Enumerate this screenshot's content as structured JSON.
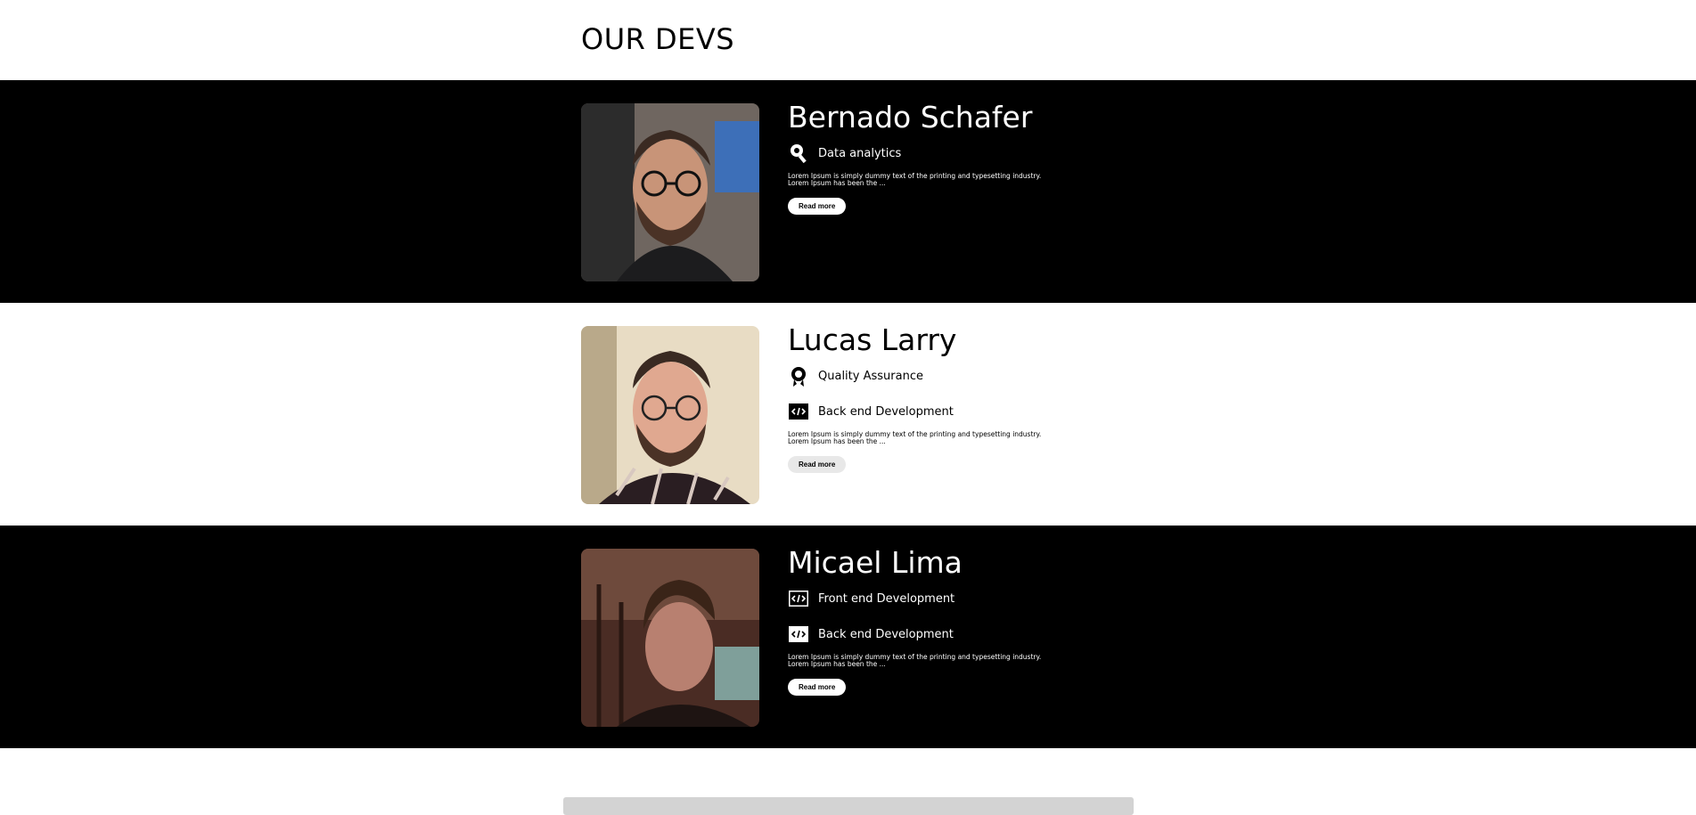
{
  "page": {
    "title": "OUR DEVS"
  },
  "devs": [
    {
      "name": "Bernado Schafer",
      "skills": [
        {
          "icon": "data-analytics-icon",
          "label": "Data analytics"
        }
      ],
      "description": "Lorem Ipsum is simply dummy text of the printing and typesetting industry. Lorem Ipsum has been the ...",
      "button": "Read more"
    },
    {
      "name": "Lucas Larry",
      "skills": [
        {
          "icon": "award-icon",
          "label": "Quality Assurance"
        },
        {
          "icon": "code-icon",
          "label": "Back end Development"
        }
      ],
      "description": "Lorem Ipsum is simply dummy text of the printing and typesetting industry. Lorem Ipsum has been the ...",
      "button": "Read more"
    },
    {
      "name": "Micael Lima",
      "skills": [
        {
          "icon": "code-icon",
          "label": "Front end Development"
        },
        {
          "icon": "code-icon",
          "label": "Back end Development"
        }
      ],
      "description": "Lorem Ipsum is simply dummy text of the printing and typesetting industry. Lorem Ipsum has been the ...",
      "button": "Read more"
    }
  ],
  "colors": {
    "dark_band": "#000000",
    "light_band": "#ffffff",
    "footer_bar": "#d3d3d3"
  }
}
